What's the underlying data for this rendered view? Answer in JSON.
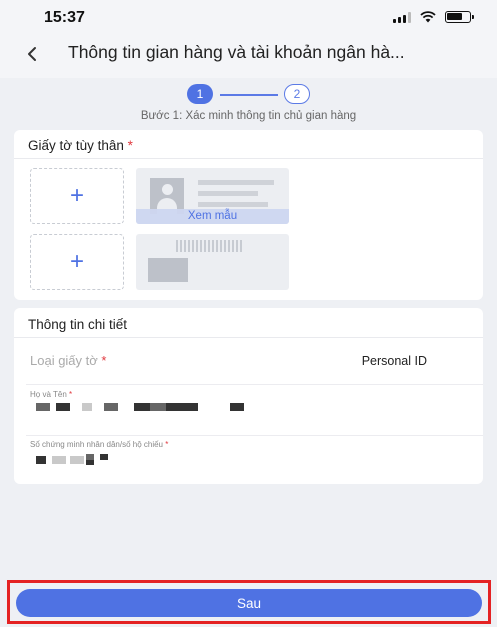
{
  "status_bar": {
    "time": "15:37"
  },
  "header": {
    "title": "Thông tin gian hàng và tài khoản ngân hà..."
  },
  "stepper": {
    "step1": "1",
    "step2": "2",
    "caption": "Bước 1: Xác minh thông tin chủ gian hàng"
  },
  "id_card_section": {
    "title": "Giấy tờ tùy thân",
    "required_mark": "*",
    "upload_symbol": "+",
    "sample_label": "Xem mẫu"
  },
  "details_section": {
    "title": "Thông tin chi tiết",
    "doc_type_label": "Loại giấy tờ",
    "required_mark": "*",
    "doc_type_value": "Personal ID",
    "name_label": "Họ và Tên",
    "id_number_label": "Số chứng minh nhân dân/số hộ chiếu"
  },
  "footer": {
    "next_label": "Sau"
  },
  "colors": {
    "accent": "#4f72e3",
    "required": "#e0383e",
    "highlight_border": "#e42223"
  },
  "icons": {
    "back": "chevron-left-icon",
    "signal": "signal-icon",
    "wifi": "wifi-icon",
    "battery": "battery-icon",
    "upload": "plus-icon"
  }
}
